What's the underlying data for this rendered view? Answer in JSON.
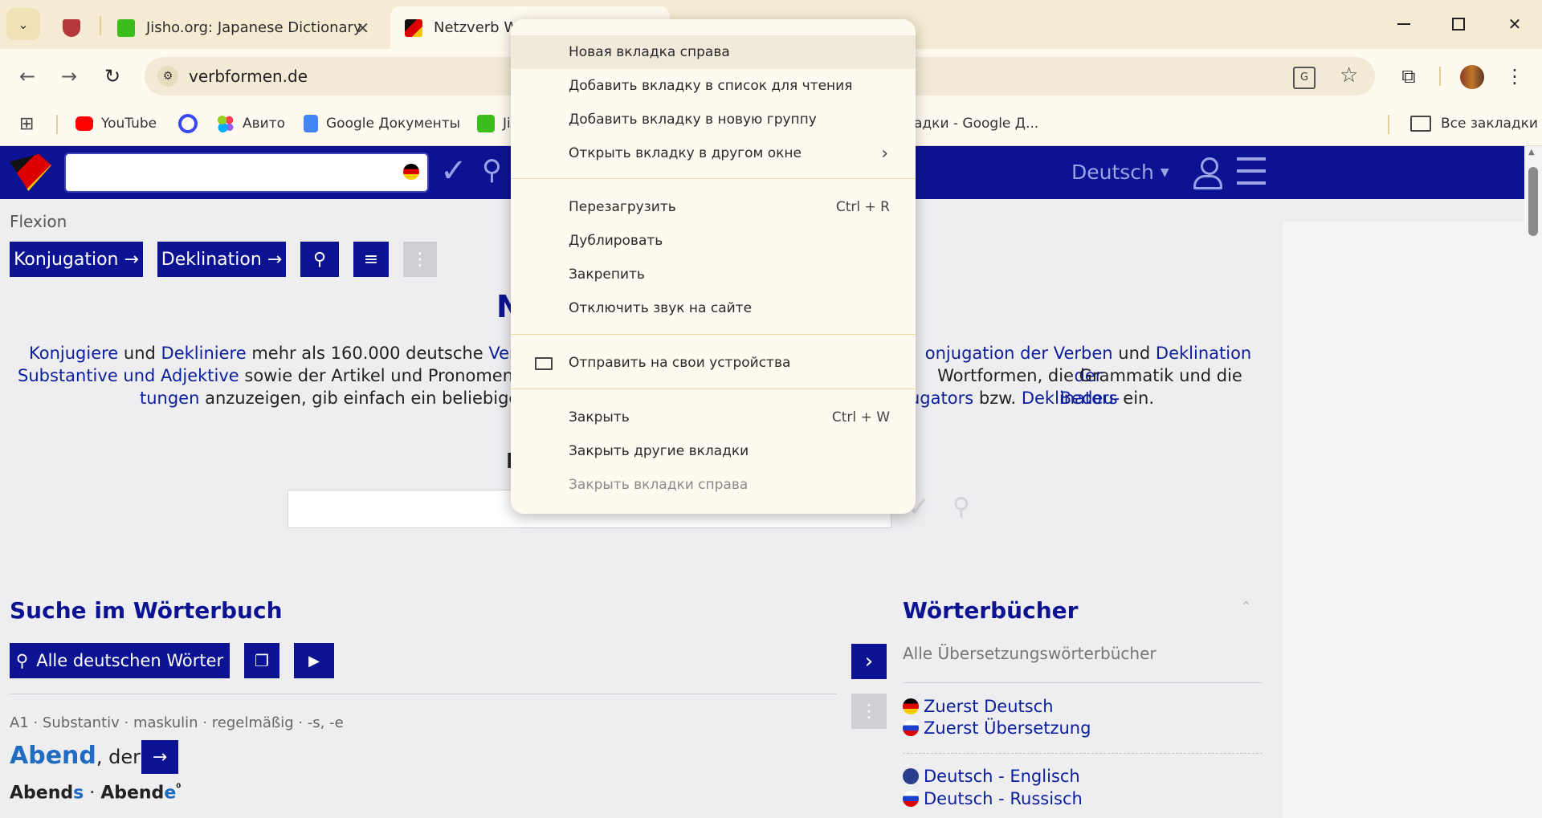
{
  "tabs": [
    {
      "label": ""
    },
    {
      "label": "Jisho.org: Japanese Dictionary"
    },
    {
      "label": "Netzverb Wö"
    }
  ],
  "toolbar": {
    "url": "verbformen.de"
  },
  "bookmarks": {
    "items": [
      "YouTube",
      "Авито",
      "Google Документы",
      "Ji",
      "адки - Google Д..."
    ],
    "all": "Все закладки"
  },
  "site": {
    "language": "Deutsch",
    "flexion_label": "Flexion",
    "konjugation_btn": "Konjugation →",
    "deklination_btn": "Deklination →",
    "heading_partial": "N",
    "heading2_partial": "I",
    "intro": {
      "l1a": "Konjugiere",
      "l1b": "und",
      "l1c": "Dekliniere",
      "l1d": "mehr als 160.000 deutsche",
      "l1e": "Verben,",
      "l1f": "onjugation der Verben",
      "l1g": "und",
      "l1h": "Deklination der",
      "l2a": "Substantive und Adjektive",
      "l2b": "sowie der Artikel und Pronomen zeigt",
      "l2c": "Wortformen, die Grammatik und die",
      "l2d": "Bedeu-",
      "l3a": "tungen",
      "l3b": "anzuzeigen, gib einfach ein beliebiges W",
      "l3c": "ugators",
      "l3d": "bzw.",
      "l3e": "Deklinators",
      "l3f": "ein."
    },
    "suche_title": "Suche im Wörterbuch",
    "alle_btn": "Alle deutschen Wörter",
    "entry_meta": "A1 · Substantiv · maskulin · regelmäßig · -s, -e",
    "entry_word": "Abend",
    "entry_article": ", der",
    "forms_a1": "Abend",
    "forms_a2": "s",
    "forms_sep": " · ",
    "forms_b1": "Abend",
    "forms_b2": "e",
    "forms_b3": "⁰",
    "woerterbuecher_title": "Wörterbücher",
    "alle_uebersetzung": "Alle Übersetzungswörterbücher",
    "zuerst_deutsch": "Zuerst Deutsch",
    "zuerst_uebersetzung": "Zuerst Übersetzung",
    "de_en": "Deutsch - Englisch",
    "de_ru": "Deutsch - Russisch"
  },
  "context_menu": {
    "new_tab_right": "Новая вкладка справа",
    "add_reading_list": "Добавить вкладку в список для чтения",
    "add_new_group": "Добавить вкладку в новую группу",
    "open_other_window": "Открыть вкладку в другом окне",
    "reload": "Перезагрузить",
    "reload_sc": "Ctrl + R",
    "duplicate": "Дублировать",
    "pin": "Закрепить",
    "mute": "Отключить звук на сайте",
    "send_devices": "Отправить на свои устройства",
    "close": "Закрыть",
    "close_sc": "Ctrl + W",
    "close_others": "Закрыть другие вкладки",
    "close_right": "Закрыть вкладки справа"
  },
  "colors": {
    "site_blue": "#0c1392",
    "link": "#0b1f9c",
    "tabstrip": "#f6ecd3"
  }
}
